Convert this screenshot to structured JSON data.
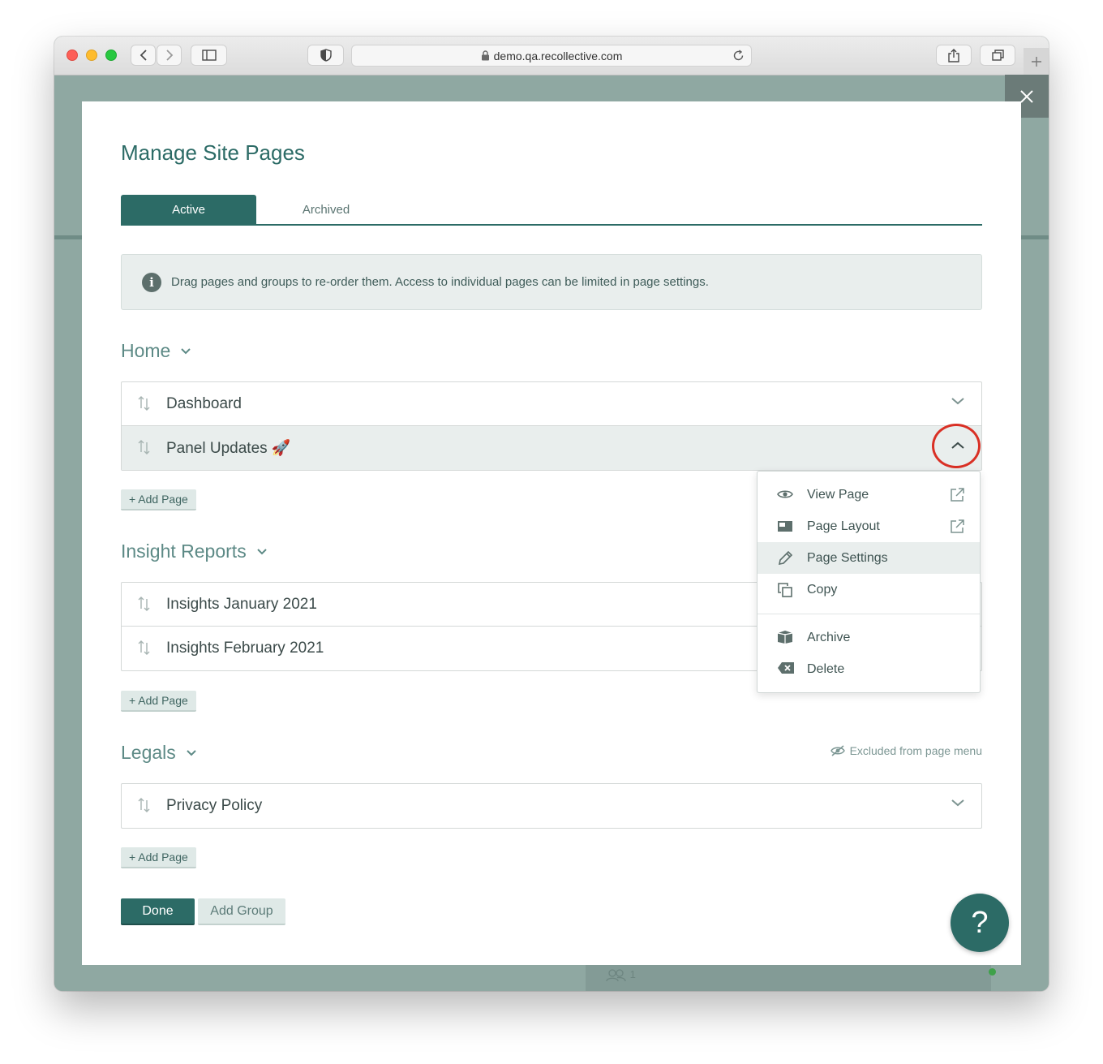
{
  "browser": {
    "url": "demo.qa.recollective.com"
  },
  "modal": {
    "title": "Manage Site Pages",
    "tabs": [
      {
        "label": "Active",
        "active": true
      },
      {
        "label": "Archived",
        "active": false
      }
    ],
    "info_text": "Drag pages and groups to re-order them. Access to individual pages can be limited in page settings.",
    "add_page_label": "+ Add Page",
    "groups": [
      {
        "title": "Home",
        "pages": [
          "Dashboard",
          "Panel Updates 🚀"
        ]
      },
      {
        "title": "Insight Reports",
        "pages": [
          "Insights January 2021",
          "Insights February 2021"
        ]
      },
      {
        "title": "Legals",
        "excluded_label": "Excluded from page menu",
        "pages": [
          "Privacy Policy"
        ]
      }
    ],
    "buttons": {
      "done": "Done",
      "add_group": "Add Group"
    }
  },
  "context_menu": {
    "items": [
      {
        "label": "View Page",
        "icon": "eye-icon",
        "external": true
      },
      {
        "label": "Page Layout",
        "icon": "layout-icon",
        "external": true
      },
      {
        "label": "Page Settings",
        "icon": "pencil-icon",
        "active": true
      },
      {
        "label": "Copy",
        "icon": "copy-icon"
      },
      {
        "label": "Archive",
        "icon": "archive-icon"
      },
      {
        "label": "Delete",
        "icon": "delete-icon"
      }
    ]
  },
  "help_label": "?",
  "footer": {
    "users_count": "1"
  },
  "colors": {
    "brand": "#2c6b66",
    "backdrop": "#8fa8a2",
    "highlight_ring": "#d93025"
  }
}
